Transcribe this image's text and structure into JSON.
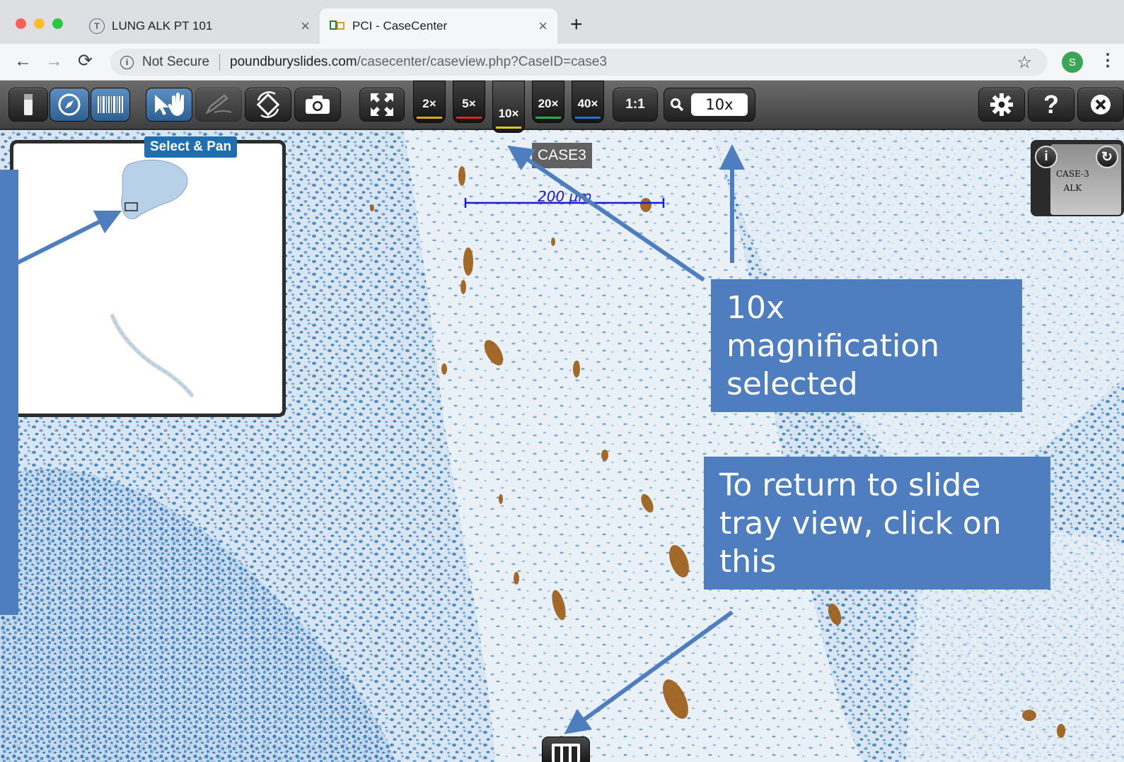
{
  "browser": {
    "tabs": [
      {
        "title": "LUNG ALK PT 101",
        "favicon": "T",
        "active": false
      },
      {
        "title": "PCI - CaseCenter",
        "favicon": "CC",
        "active": true
      }
    ],
    "new_tab": "+",
    "security_label": "Not Secure",
    "url_host": "poundburyslides.com",
    "url_path": "/casecenter/caseview.php?CaseID=case3",
    "profile_initial": "S"
  },
  "toolbar": {
    "magnifications": [
      {
        "label": "2×",
        "color": "#e0a21a"
      },
      {
        "label": "5×",
        "color": "#d9262a"
      },
      {
        "label": "10×",
        "color": "#e8c51c",
        "selected": true
      },
      {
        "label": "20×",
        "color": "#2fa84a"
      },
      {
        "label": "40×",
        "color": "#2a6fd0"
      }
    ],
    "one_to_one": "1:1",
    "zoom_value": "10x"
  },
  "viewer": {
    "mode_label": "Select & Pan",
    "case_label": "CASE3",
    "scale_bar": "200 µm",
    "slide_label_line1": "CASE-3",
    "slide_label_line2": "ALK"
  },
  "annotations": {
    "magnification_callout": "10x magnification selected",
    "tray_callout": "To return to slide tray view, click on this",
    "accent_color": "#4e7ec0"
  }
}
